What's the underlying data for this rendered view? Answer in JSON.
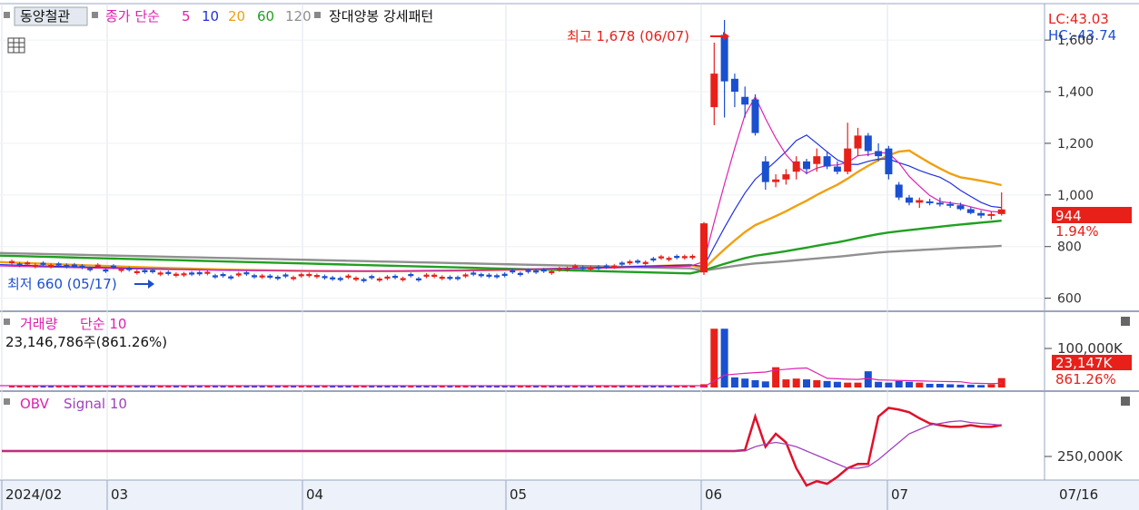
{
  "toolbar": {
    "stock_name": "동양철관",
    "ma_label": "종가 단순",
    "ma_periods": [
      "5",
      "10",
      "20",
      "60",
      "120"
    ],
    "ma_colors": [
      "#e020b0",
      "#2030e0",
      "#f0a010",
      "#20a020",
      "#909090"
    ],
    "pattern_label": "장대양봉 강세패턴"
  },
  "price_panel": {
    "high_annotation": "최고 1,678 (06/07)",
    "low_annotation": "최저 660 (05/17)",
    "lc": "LC:43.03",
    "hc": "HC:-43.74",
    "current_price": "944",
    "change_pct": "1.94%",
    "y_ticks": [
      "1,600",
      "1,400",
      "1,200",
      "1,000",
      "800",
      "600"
    ]
  },
  "volume_panel": {
    "title": "거래량",
    "indicator": "단순 10",
    "volume_text": "23,146,786주(861.26%)",
    "y_tick": "100,000K",
    "current_value": "23,147K",
    "current_pct": "861.26%"
  },
  "obv_panel": {
    "title": "OBV",
    "indicator": "Signal 10",
    "y_tick": "250,000K"
  },
  "x_axis": {
    "labels": [
      "2024/02",
      "03",
      "04",
      "05",
      "06",
      "07"
    ],
    "right_label": "07/16"
  },
  "colors": {
    "up": "#e8201a",
    "down": "#1a4fd0",
    "ma5": "#e020b0",
    "ma10": "#2030e0",
    "ma20": "#f0a010",
    "ma60": "#20a020",
    "ma120": "#909090",
    "obv": "#e0102a",
    "signal": "#a040c0"
  },
  "chart_data": [
    {
      "type": "candlestick",
      "title": "동양철관",
      "x": [
        "2024/02",
        "03",
        "04",
        "05",
        "06",
        "07",
        "07/16"
      ],
      "ylim": [
        560,
        1720
      ],
      "candles": [
        {
          "t": "06-03",
          "o": 700,
          "h": 895,
          "l": 690,
          "c": 890
        },
        {
          "t": "06-04",
          "o": 1340,
          "h": 1590,
          "l": 1270,
          "c": 1470
        },
        {
          "t": "06-05",
          "o": 1620,
          "h": 1678,
          "l": 1300,
          "c": 1440
        },
        {
          "t": "06-07",
          "o": 1450,
          "h": 1470,
          "l": 1340,
          "c": 1400
        },
        {
          "t": "06-10",
          "o": 1380,
          "h": 1420,
          "l": 1300,
          "c": 1350
        },
        {
          "t": "06-11",
          "o": 1370,
          "h": 1390,
          "l": 1230,
          "c": 1240
        },
        {
          "t": "06-12",
          "o": 1130,
          "h": 1150,
          "l": 1020,
          "c": 1050
        },
        {
          "t": "06-13",
          "o": 1050,
          "h": 1080,
          "l": 1030,
          "c": 1060
        },
        {
          "t": "06-14",
          "o": 1060,
          "h": 1100,
          "l": 1040,
          "c": 1080
        },
        {
          "t": "06-17",
          "o": 1090,
          "h": 1150,
          "l": 1060,
          "c": 1130
        },
        {
          "t": "06-18",
          "o": 1130,
          "h": 1140,
          "l": 1080,
          "c": 1100
        },
        {
          "t": "06-19",
          "o": 1120,
          "h": 1180,
          "l": 1090,
          "c": 1150
        },
        {
          "t": "06-20",
          "o": 1150,
          "h": 1170,
          "l": 1100,
          "c": 1110
        },
        {
          "t": "06-21",
          "o": 1110,
          "h": 1130,
          "l": 1080,
          "c": 1090
        },
        {
          "t": "06-24",
          "o": 1090,
          "h": 1280,
          "l": 1080,
          "c": 1180
        },
        {
          "t": "06-25",
          "o": 1180,
          "h": 1260,
          "l": 1150,
          "c": 1230
        },
        {
          "t": "06-26",
          "o": 1230,
          "h": 1240,
          "l": 1150,
          "c": 1170
        },
        {
          "t": "06-27",
          "o": 1170,
          "h": 1200,
          "l": 1130,
          "c": 1150
        },
        {
          "t": "07-01",
          "o": 1180,
          "h": 1190,
          "l": 1060,
          "c": 1080
        },
        {
          "t": "07-02",
          "o": 1040,
          "h": 1050,
          "l": 980,
          "c": 990
        },
        {
          "t": "07-03",
          "o": 990,
          "h": 1000,
          "l": 960,
          "c": 970
        },
        {
          "t": "07-04",
          "o": 970,
          "h": 990,
          "l": 950,
          "c": 980
        },
        {
          "t": "07-05",
          "o": 975,
          "h": 985,
          "l": 960,
          "c": 970
        },
        {
          "t": "07-08",
          "o": 970,
          "h": 990,
          "l": 955,
          "c": 965
        },
        {
          "t": "07-09",
          "o": 965,
          "h": 975,
          "l": 950,
          "c": 960
        },
        {
          "t": "07-10",
          "o": 960,
          "h": 970,
          "l": 940,
          "c": 945
        },
        {
          "t": "07-11",
          "o": 945,
          "h": 955,
          "l": 925,
          "c": 930
        },
        {
          "t": "07-12",
          "o": 930,
          "h": 940,
          "l": 910,
          "c": 920
        },
        {
          "t": "07-15",
          "o": 920,
          "h": 935,
          "l": 905,
          "c": 926
        },
        {
          "t": "07-16",
          "o": 926,
          "h": 1010,
          "l": 920,
          "c": 944
        }
      ],
      "pre_june_range": [
        660,
        760
      ],
      "high": {
        "value": 1678,
        "date": "06/07"
      },
      "low": {
        "value": 660,
        "date": "05/17"
      }
    },
    {
      "type": "bar",
      "title": "거래량",
      "y_tick": "100,000K",
      "current": "23,147K",
      "values_k": [
        8000,
        145000,
        145000,
        25000,
        22000,
        18000,
        15000,
        50000,
        20000,
        22000,
        20000,
        18000,
        16000,
        14000,
        12000,
        12000,
        40000,
        14000,
        12000,
        16000,
        14000,
        12000,
        9000,
        9000,
        8000,
        7000,
        7000,
        6000,
        8000,
        23147
      ]
    },
    {
      "type": "line",
      "title": "OBV",
      "y_tick": "250,000K",
      "series": [
        {
          "name": "OBV",
          "values": [
            0,
            0,
            0,
            0,
            1,
            40,
            5,
            20,
            10,
            -20,
            -40,
            -35,
            -38,
            -30,
            -20,
            -15,
            -15,
            40,
            50,
            48,
            45,
            38,
            32,
            30,
            28,
            28,
            30,
            28,
            28,
            30
          ]
        },
        {
          "name": "Signal 10",
          "values": [
            0,
            0,
            0,
            0,
            0,
            5,
            8,
            10,
            8,
            5,
            0,
            -5,
            -10,
            -15,
            -20,
            -20,
            -18,
            -10,
            0,
            10,
            20,
            25,
            30,
            32,
            34,
            35,
            33,
            32,
            31,
            30
          ]
        }
      ]
    }
  ]
}
